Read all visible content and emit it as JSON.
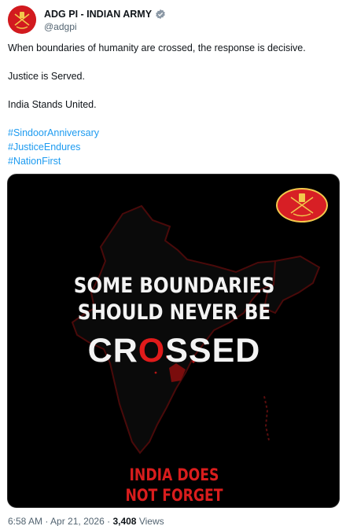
{
  "account": {
    "name": "ADG PI - INDIAN ARMY",
    "handle": "@adgpi",
    "verified_badge_color": "#8b98a5"
  },
  "tweet": {
    "line1": "When boundaries of humanity are crossed, the response is decisive.",
    "line2": "Justice is Served.",
    "line3": "India Stands United.",
    "hashtags": [
      "#SindoorAnniversary",
      "#JusticeEndures",
      "#NationFirst"
    ]
  },
  "media": {
    "headline_line1": "SOME BOUNDARIES",
    "headline_line2": "SHOULD NEVER BE",
    "headline_word_start": "CR",
    "headline_word_o": "O",
    "headline_word_end": "SSED",
    "bottom_line1": "INDIA DOES",
    "bottom_line2": "NOT FORGET",
    "accent_color": "#d91d1d",
    "background_color": "#000000",
    "emblem_icon": "indian-army-emblem-icon"
  },
  "footer": {
    "time": "6:58 AM",
    "separator1": "·",
    "date": "Apr 21, 2026",
    "separator2": "·",
    "views_count": "3,408",
    "views_label": "Views"
  }
}
